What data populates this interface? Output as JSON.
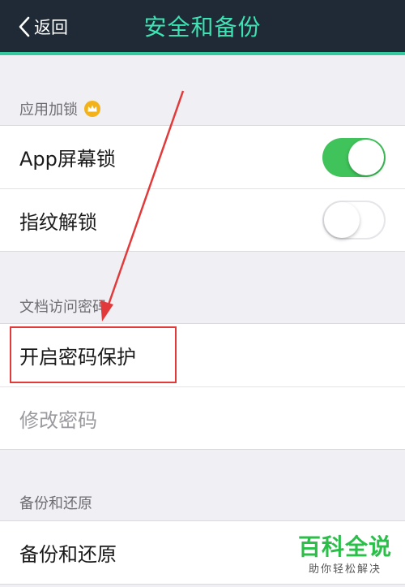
{
  "navbar": {
    "back_label": "返回",
    "title": "安全和备份"
  },
  "sections": [
    {
      "label": "应用加锁",
      "badge_icon": "crown-icon",
      "rows": [
        {
          "label": "App屏幕锁",
          "toggle": true
        },
        {
          "label": "指纹解锁",
          "toggle": false
        }
      ]
    },
    {
      "label": "文档访问密码",
      "rows": [
        {
          "label": "开启密码保护"
        },
        {
          "label": "修改密码",
          "enabled": false
        }
      ]
    },
    {
      "label": "备份和还原",
      "rows": [
        {
          "label": "备份和还原"
        }
      ]
    }
  ],
  "watermark": {
    "title": "百科全说",
    "subtitle": "助你轻松解决"
  },
  "colors": {
    "navbar_bg": "#1f2a36",
    "accent": "#3ee3b3",
    "toggle_on": "#3fc35a",
    "annotation": "#e23a3a",
    "watermark": "#2bbf4a"
  }
}
